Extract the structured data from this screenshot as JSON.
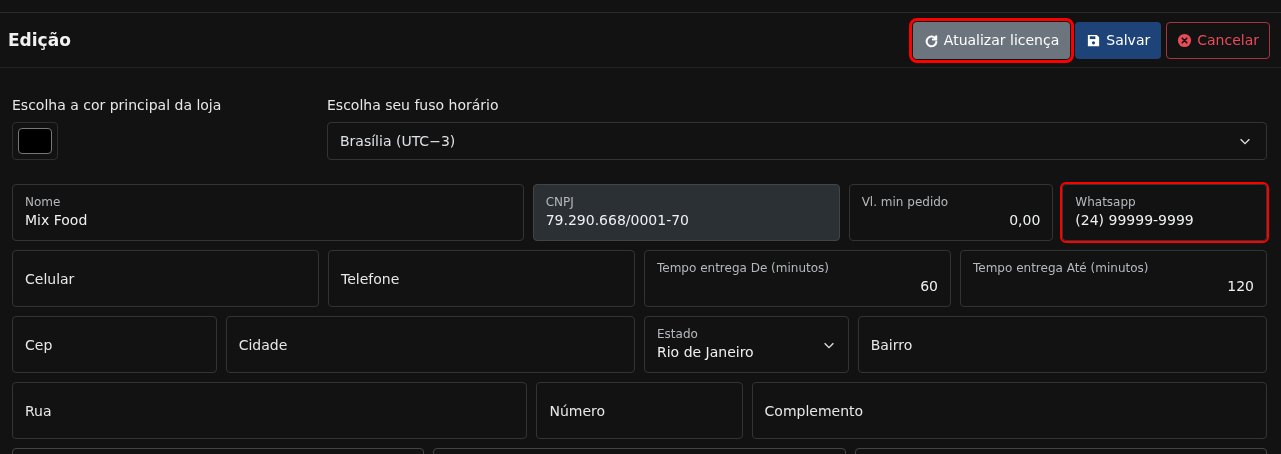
{
  "header": {
    "title": "Edição",
    "buttons": [
      {
        "label": "Atualizar licença",
        "kind": "secondary",
        "highlighted": true
      },
      {
        "label": "Salvar",
        "kind": "primary",
        "highlighted": false
      },
      {
        "label": "Cancelar",
        "kind": "danger",
        "highlighted": false
      }
    ]
  },
  "color_picker": {
    "label": "Escolha a cor principal da loja",
    "color": "#000000"
  },
  "timezone": {
    "label": "Escolha seu fuso horário",
    "value": "Brasília (UTC−3)"
  },
  "rows": [
    [
      {
        "label": "Nome",
        "value": "Mix Food",
        "kind": "text",
        "disabled": false,
        "highlighted": false
      },
      {
        "label": "CNPJ",
        "value": "79.290.668/0001-70",
        "kind": "text",
        "disabled": true,
        "highlighted": false
      },
      {
        "label": "Vl. min pedido",
        "value": "0,00",
        "kind": "number",
        "disabled": false,
        "highlighted": false
      },
      {
        "label": "Whatsapp",
        "value": "(24) 99999-9999",
        "kind": "text",
        "disabled": false,
        "highlighted": true
      }
    ],
    [
      {
        "placeholder": "Celular",
        "kind": "text",
        "disabled": false,
        "highlighted": false
      },
      {
        "placeholder": "Telefone",
        "kind": "text",
        "disabled": false,
        "highlighted": false
      },
      {
        "label": "Tempo entrega De (minutos)",
        "value": "60",
        "kind": "number",
        "disabled": false,
        "highlighted": false
      },
      {
        "label": "Tempo entrega Até (minutos)",
        "value": "120",
        "kind": "number",
        "disabled": false,
        "highlighted": false
      }
    ],
    [
      {
        "placeholder": "Cep",
        "kind": "text",
        "disabled": false,
        "highlighted": false
      },
      {
        "placeholder": "Cidade",
        "kind": "text",
        "disabled": false,
        "highlighted": false
      },
      {
        "label": "Estado",
        "value": "Rio de Janeiro",
        "kind": "select",
        "disabled": false,
        "highlighted": false
      },
      {
        "placeholder": "Bairro",
        "kind": "text",
        "disabled": false,
        "highlighted": false
      }
    ],
    [
      {
        "placeholder": "Rua",
        "kind": "text",
        "disabled": false,
        "highlighted": false
      },
      {
        "placeholder": "Número",
        "kind": "text",
        "disabled": false,
        "highlighted": false
      },
      {
        "placeholder": "Complemento",
        "kind": "text",
        "disabled": false,
        "highlighted": false
      }
    ]
  ]
}
